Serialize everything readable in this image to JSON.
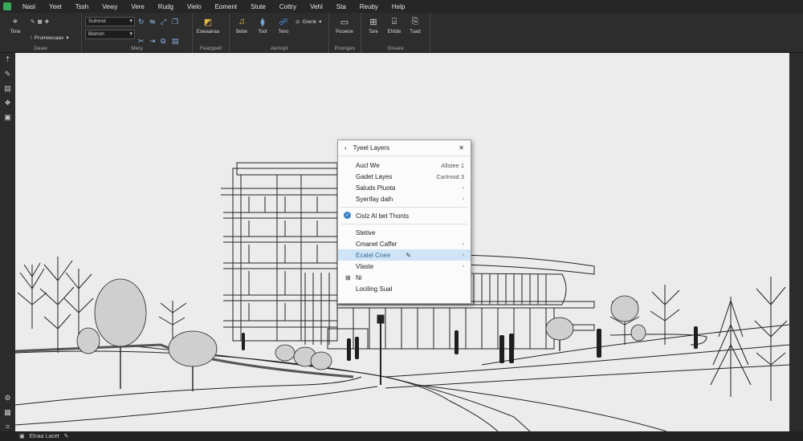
{
  "menu": [
    "Nasl",
    "Yeet",
    "Tssh",
    "Vewy",
    "Vere",
    "Rudg",
    "Vielo",
    "Eoment",
    "Stute",
    "Cottry",
    "Vehl",
    "Sta",
    "Reuby",
    "Help"
  ],
  "ribbon": {
    "draw": {
      "label": "Deaw",
      "tool_label": "Time",
      "property_label": "Prumeecaav"
    },
    "modify": {
      "label": "Mery",
      "combo1": "Sulnnol",
      "combo2": "Bishon"
    },
    "layers": {
      "label": "Fearppell",
      "button_label": "Eowaanaa"
    },
    "annotate": {
      "label": "Awnopt",
      "buttons": [
        "Bebe",
        "Toot",
        "Teno",
        "Grenk"
      ]
    },
    "properties": {
      "label": "Poonges",
      "button_label": "Poowoe"
    },
    "create": {
      "label": "Greare",
      "buttons": [
        "Tare",
        "Ehilde",
        "Tuad"
      ]
    }
  },
  "context_menu": {
    "title": "Tyeel Layers",
    "items": [
      {
        "label": "Aucl We",
        "shortcut": "Allstee 1",
        "arrow": false
      },
      {
        "label": "Gadet Layes",
        "shortcut": "Carlmod 3",
        "arrow": false
      },
      {
        "label": "Saluds Pluota",
        "shortcut": "",
        "arrow": true
      },
      {
        "label": "Syerifay daih",
        "shortcut": "",
        "arrow": true
      }
    ],
    "checked_item": "Cislz Al bet Thonts",
    "items2": [
      {
        "label": "Stetive",
        "shortcut": "",
        "arrow": false
      },
      {
        "label": "Cmanel Caffer",
        "shortcut": "",
        "arrow": true
      },
      {
        "label": "Ecalel Cnee",
        "shortcut": "",
        "arrow": true,
        "highlight": true
      },
      {
        "label": "Vlaste",
        "shortcut": "",
        "arrow": true
      },
      {
        "label": "Ni",
        "shortcut": "",
        "arrow": false
      },
      {
        "label": "Lociling Sual",
        "shortcut": "",
        "arrow": false
      }
    ]
  },
  "status": {
    "text": "Elnaa Lacet"
  },
  "colors": {
    "accent": "#3b82c4",
    "canvas": "#ececec",
    "chrome": "#2b2b2b"
  }
}
